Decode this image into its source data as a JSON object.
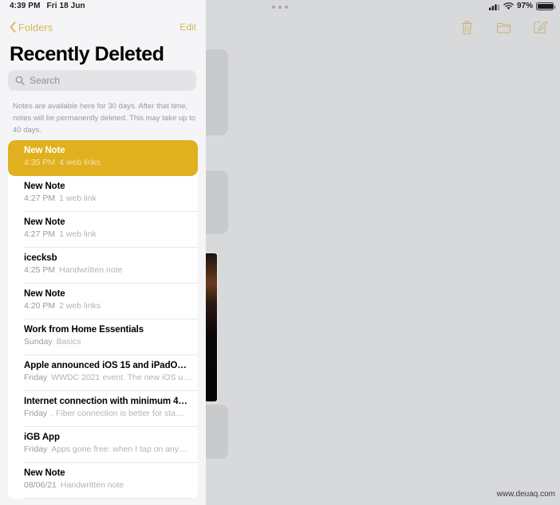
{
  "status_bar": {
    "time": "4:39 PM",
    "date": "Fri 18 Jun",
    "battery_percent": "97%",
    "signal_icon": "cellular-signal-icon",
    "wifi_icon": "wifi-icon",
    "battery_icon": "battery-icon"
  },
  "toolbar": {
    "delete_icon": "trash-icon",
    "move_icon": "folder-icon",
    "compose_icon": "compose-icon"
  },
  "nav": {
    "back_label": "Folders",
    "back_icon": "chevron-left-icon",
    "edit_label": "Edit"
  },
  "page_title": "Recently Deleted",
  "search": {
    "placeholder": "Search",
    "icon": "search-icon"
  },
  "info_text": "Notes are available here for 30 days. After that time, notes will be permanently deleted. This may take up to 40 days.",
  "notes": [
    {
      "title": "New Note",
      "date": "4:35 PM",
      "snippet": "4 web links",
      "selected": true
    },
    {
      "title": "New Note",
      "date": "4:27 PM",
      "snippet": "1 web link",
      "selected": false
    },
    {
      "title": "New Note",
      "date": "4:27 PM",
      "snippet": "1 web link",
      "selected": false
    },
    {
      "title": "icecksb",
      "date": "4:25 PM",
      "snippet": "Handwritten note",
      "selected": false
    },
    {
      "title": "New Note",
      "date": "4:20 PM",
      "snippet": "2 web links",
      "selected": false
    },
    {
      "title": "Work from Home Essentials",
      "date": "Sunday",
      "snippet": "Basics",
      "selected": false
    },
    {
      "title": "Apple announced iOS 15 and iPadO…",
      "date": "Friday",
      "snippet": "WWDC 2021 event. The new iOS u…",
      "selected": false
    },
    {
      "title": "Internet connection with minimum 4…",
      "date": "Friday",
      "snippet": ". Fiber connection is better for sta…",
      "selected": false
    },
    {
      "title": "iGB App",
      "date": "Friday",
      "snippet": "Apps gone free: when I tap on any…",
      "selected": false
    },
    {
      "title": "New Note",
      "date": "08/06/21",
      "snippet": "Handwritten note",
      "selected": false
    }
  ],
  "watermark": "www.deuaq.com",
  "colors": {
    "accent": "#d6b659",
    "selected_row": "#e0b01e",
    "sidebar_bg": "#f5f5f7",
    "canvas_bg": "#d8d9db",
    "list_bg": "#ffffff"
  }
}
